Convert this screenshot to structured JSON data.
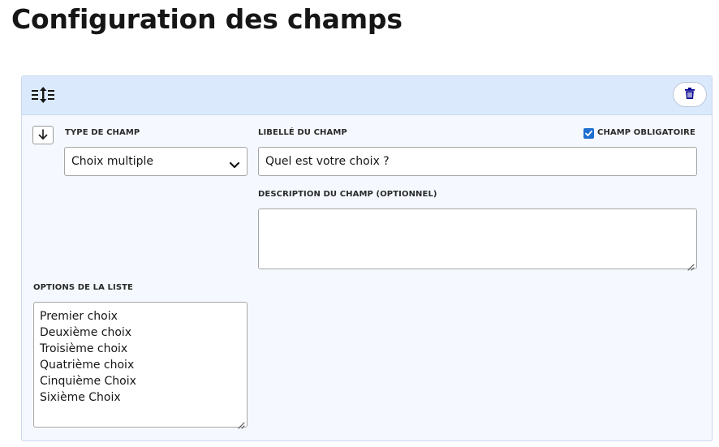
{
  "page": {
    "title": "Configuration des champs"
  },
  "field_card": {
    "drag_icon": "drag-reorder-icon",
    "delete_icon": "trash-icon",
    "move_down_icon": "arrow-down-icon",
    "type": {
      "label": "TYPE DE CHAMP",
      "value": "Choix multiple"
    },
    "field_label": {
      "label": "LIBELLÉ DU CHAMP",
      "value": "Quel est votre choix ?"
    },
    "required": {
      "label": "CHAMP OBLIGATOIRE",
      "checked": true
    },
    "description": {
      "label": "DESCRIPTION DU CHAMP (OPTIONNEL)",
      "value": ""
    },
    "options": {
      "label": "OPTIONS DE LA LISTE",
      "items": [
        "Premier choix",
        "Deuxième choix",
        "Troisième choix",
        "Quatrième choix",
        "Cinquième Choix",
        "Sixième Choix"
      ]
    }
  },
  "colors": {
    "header_bg": "#dbe9fd",
    "card_bg": "#f5f9ff",
    "accent": "#1f6fd1",
    "icon_dark": "#000091"
  }
}
